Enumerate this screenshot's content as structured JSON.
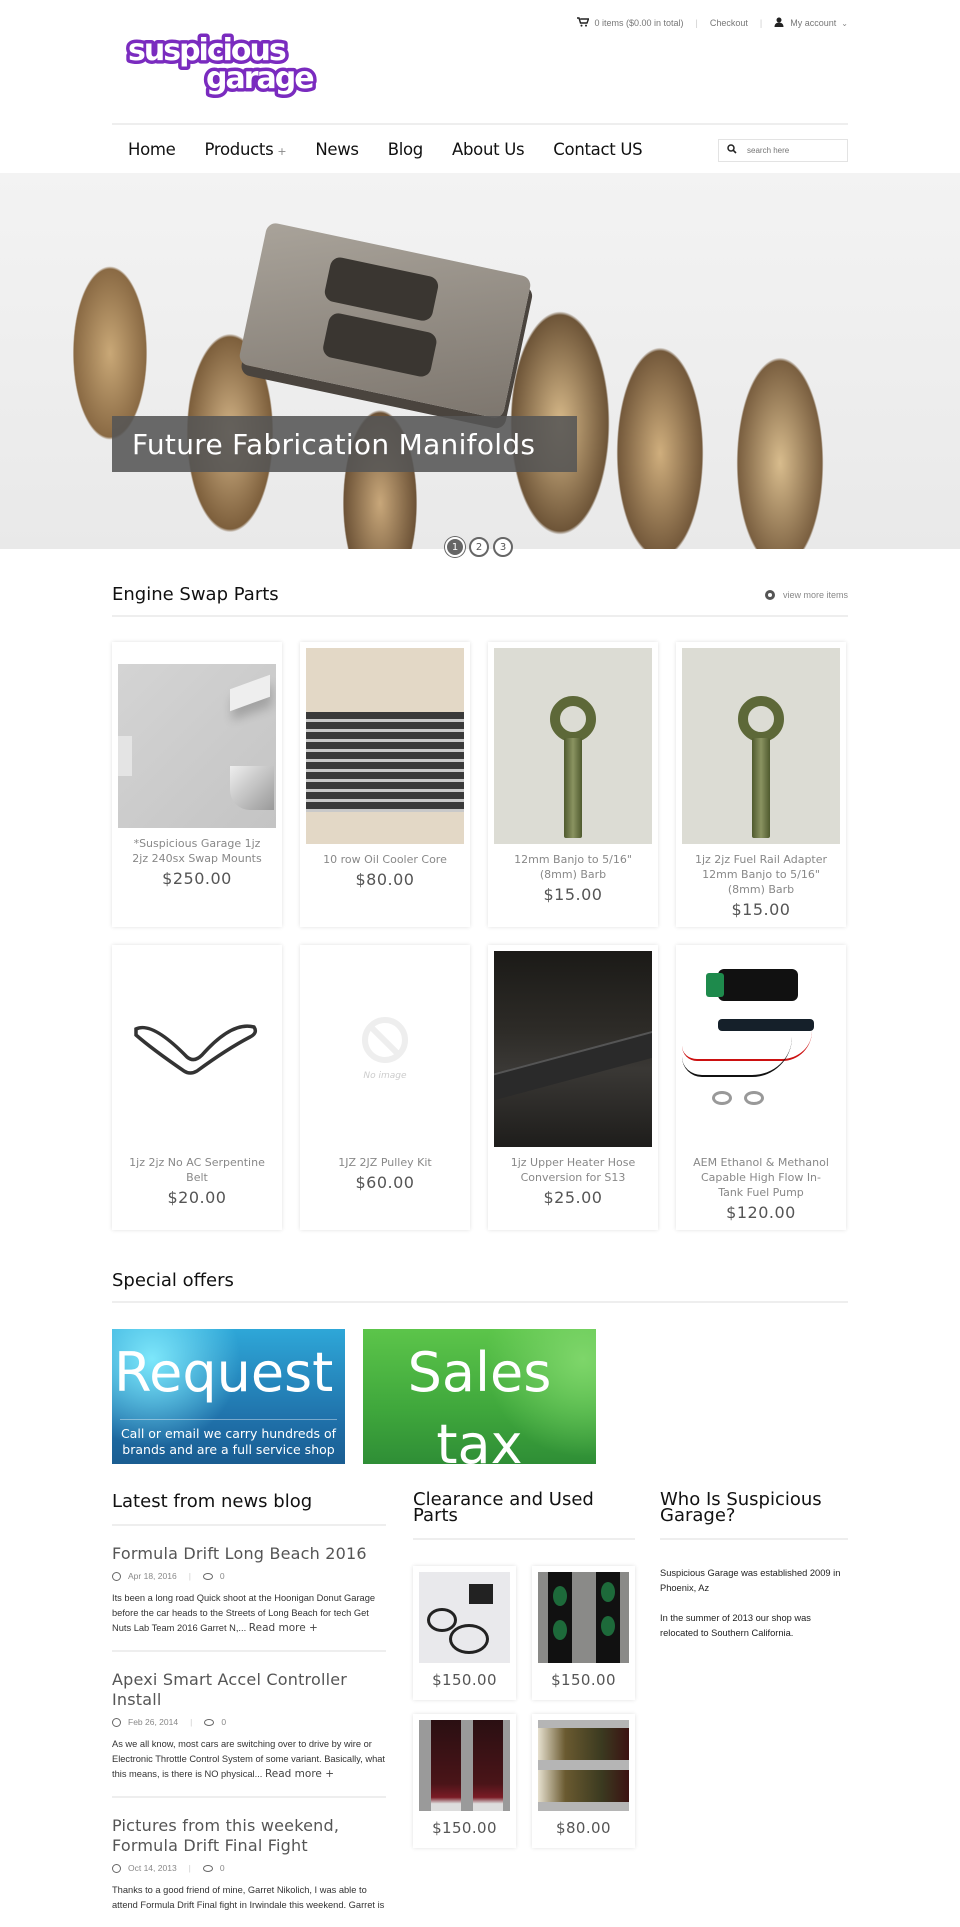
{
  "header": {
    "logo_text": "suspicious garage",
    "brand_color": "#7a2bbf",
    "cart_summary": "0 items ($0.00 in total)",
    "checkout_label": "Checkout",
    "account_label": "My account"
  },
  "nav": {
    "items": [
      {
        "label": "Home"
      },
      {
        "label": "Products",
        "has_submenu": true,
        "submenu_marker": "+"
      },
      {
        "label": "News"
      },
      {
        "label": "Blog"
      },
      {
        "label": "About Us"
      },
      {
        "label": "Contact US"
      }
    ],
    "search_placeholder": "search here"
  },
  "hero": {
    "caption": "Future Fabrication Manifolds",
    "slides": [
      "1",
      "2",
      "3"
    ],
    "active_slide": 1
  },
  "engine_swap": {
    "title": "Engine Swap Parts",
    "view_more_label": "view more items",
    "products": [
      {
        "title": "*Suspicious Garage 1jz 2jz 240sx Swap Mounts",
        "price": "$250.00",
        "image": "swap-mounts"
      },
      {
        "title": "10 row Oil Cooler Core",
        "price": "$80.00",
        "image": "oil-cooler"
      },
      {
        "title": "12mm Banjo to 5/16\" (8mm) Barb",
        "price": "$15.00",
        "image": "banjo-fitting"
      },
      {
        "title": "1jz 2jz Fuel Rail Adapter 12mm Banjo to 5/16\" (8mm) Barb",
        "price": "$15.00",
        "image": "banjo-fitting"
      },
      {
        "title": "1jz 2jz No AC Serpentine Belt",
        "price": "$20.00",
        "image": "serpentine-belt"
      },
      {
        "title": "1JZ 2JZ Pulley Kit",
        "price": "$60.00",
        "image": "no-image",
        "no_image_label": "No image"
      },
      {
        "title": "1jz Upper Heater Hose Conversion for S13",
        "price": "$25.00",
        "image": "heater-hose"
      },
      {
        "title": "AEM Ethanol & Methanol Capable High Flow In-Tank Fuel Pump",
        "price": "$120.00",
        "image": "fuel-pump"
      }
    ]
  },
  "special_offers": {
    "title": "Special offers",
    "banners": [
      {
        "headline": "Request",
        "subtext": "Call or email we carry hundreds of brands and are a full service shop",
        "color": "#2a8fc6"
      },
      {
        "headline": "Sales",
        "headline_2": "tax",
        "color": "#47b33f"
      }
    ]
  },
  "blog": {
    "title": "Latest from news blog",
    "read_more_label": "Read more +",
    "posts": [
      {
        "title": "Formula Drift Long Beach 2016",
        "date": "Apr 18, 2016",
        "comments": "0",
        "excerpt": "Its been a long road Quick shoot at the Hoonigan Donut Garage before the car heads to the Streets of Long Beach for tech Get Nuts Lab Team 2016 Garret N,...",
        "has_read_more": true
      },
      {
        "title": "Apexi Smart Accel Controller Install",
        "date": "Feb 26, 2014",
        "comments": "0",
        "excerpt": "As we all know, most cars are switching over to drive by wire or Electronic Throttle Control System of some variant.  Basically, what this means, is there is NO physical...",
        "has_read_more": true
      },
      {
        "title": "Pictures from this weekend, Formula Drift Final Fight",
        "date": "Oct 14, 2013",
        "comments": "0",
        "excerpt": "Thanks to a good friend of mine, Garret Nikolich, I was able to attend Formula Drift Final fight in Irwindale this weekend.  Garret is",
        "has_read_more": false
      }
    ]
  },
  "clearance": {
    "title": "Clearance and Used Parts",
    "items": [
      {
        "price": "$150.00",
        "image": "controller-kit"
      },
      {
        "price": "$150.00",
        "image": "green-lamps"
      },
      {
        "price": "$150.00",
        "image": "tail-lights-vertical"
      },
      {
        "price": "$80.00",
        "image": "tail-lights-horizontal"
      }
    ]
  },
  "about": {
    "title": "Who Is Suspicious Garage?",
    "paragraphs": [
      "Suspicious Garage was established 2009 in Phoenix, Az",
      "In the summer of 2013 our shop was relocated to Southern California."
    ]
  }
}
